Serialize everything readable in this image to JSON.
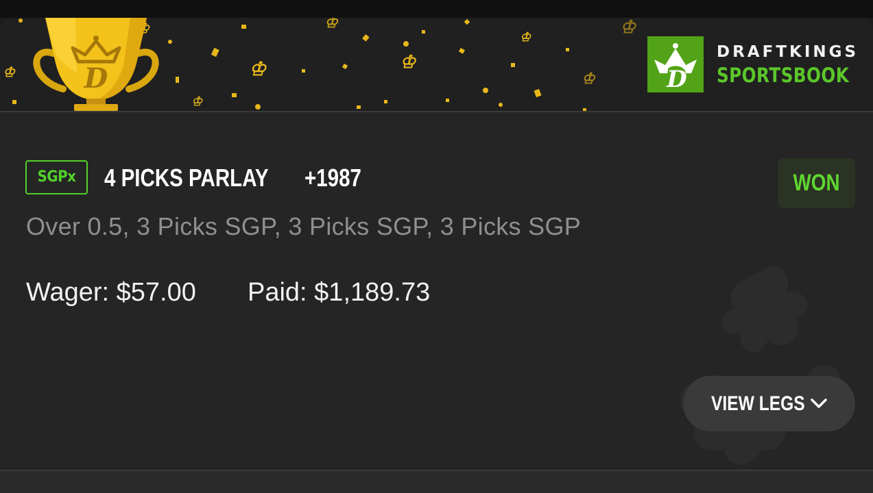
{
  "banner": {
    "brand_line1": "DRAFTKINGS",
    "brand_line2": "SPORTSBOOK",
    "trophy_icon": "trophy-icon",
    "crown_icon": "crown-icon"
  },
  "bet": {
    "badge": "SGPx",
    "title": "4 PICKS PARLAY",
    "odds": "+1987",
    "status": "WON",
    "description": "Over 0.5, 3 Picks SGP, 3 Picks SGP, 3 Picks SGP",
    "wager": "Wager: $57.00",
    "paid": "Paid: $1,189.73"
  },
  "actions": {
    "view_legs_label": "VIEW LEGS",
    "view_legs_icon": "chevron-down-icon"
  },
  "colors": {
    "brand_green": "#53a318",
    "accent_green": "#5fd630",
    "gold": "#f3c21b",
    "background": "#252525"
  }
}
